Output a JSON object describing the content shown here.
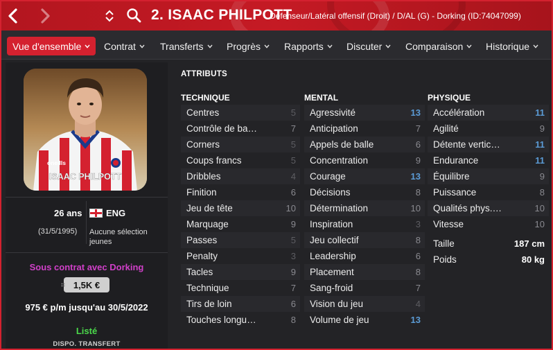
{
  "header": {
    "title": "2. ISAAC PHILPOTT",
    "subtitle": "Défenseur/Latéral offensif (Droit) / D/AL (G) - Dorking (ID:74047099)",
    "colors": {
      "accent": "#d4212f"
    }
  },
  "tabs": [
    {
      "label": "Vue d'ensemble",
      "active": true
    },
    {
      "label": "Contrat"
    },
    {
      "label": "Transferts"
    },
    {
      "label": "Progrès"
    },
    {
      "label": "Rapports"
    },
    {
      "label": "Discuter"
    },
    {
      "label": "Comparaison"
    },
    {
      "label": "Historique"
    }
  ],
  "profile": {
    "shirt_name": "ISAAC PHILPOTT",
    "shirt_brand": "oneills",
    "age": "26 ans",
    "nationality": "ENG",
    "dob": "(31/5/1995)",
    "youth": "Aucune sélection jeunes",
    "contract": "Sous contrat avec Dorking",
    "value": "1,5K €",
    "wage": "975 € p/m jusqu'au 30/5/2022",
    "transfer_status": "Listé",
    "transfer_label": "DISPO. TRANSFERT"
  },
  "attributes": {
    "title": "ATTRIBUTS",
    "technique": {
      "heading": "TECHNIQUE",
      "rows": [
        {
          "name": "Centres",
          "value": "5"
        },
        {
          "name": "Contrôle de ba…",
          "value": "7"
        },
        {
          "name": "Corners",
          "value": "5"
        },
        {
          "name": "Coups francs",
          "value": "5"
        },
        {
          "name": "Dribbles",
          "value": "4"
        },
        {
          "name": "Finition",
          "value": "6"
        },
        {
          "name": "Jeu de tête",
          "value": "10"
        },
        {
          "name": "Marquage",
          "value": "9"
        },
        {
          "name": "Passes",
          "value": "5"
        },
        {
          "name": "Penalty",
          "value": "3"
        },
        {
          "name": "Tacles",
          "value": "9"
        },
        {
          "name": "Technique",
          "value": "7"
        },
        {
          "name": "Tirs de loin",
          "value": "6"
        },
        {
          "name": "Touches longu…",
          "value": "8"
        }
      ]
    },
    "mental": {
      "heading": "MENTAL",
      "rows": [
        {
          "name": "Agressivité",
          "value": "13"
        },
        {
          "name": "Anticipation",
          "value": "7"
        },
        {
          "name": "Appels de balle",
          "value": "6"
        },
        {
          "name": "Concentration",
          "value": "9"
        },
        {
          "name": "Courage",
          "value": "13"
        },
        {
          "name": "Décisions",
          "value": "8"
        },
        {
          "name": "Détermination",
          "value": "10"
        },
        {
          "name": "Inspiration",
          "value": "3"
        },
        {
          "name": "Jeu collectif",
          "value": "8"
        },
        {
          "name": "Leadership",
          "value": "6"
        },
        {
          "name": "Placement",
          "value": "8"
        },
        {
          "name": "Sang-froid",
          "value": "7"
        },
        {
          "name": "Vision du jeu",
          "value": "4"
        },
        {
          "name": "Volume de jeu",
          "value": "13"
        }
      ]
    },
    "physique": {
      "heading": "PHYSIQUE",
      "rows": [
        {
          "name": "Accélération",
          "value": "11"
        },
        {
          "name": "Agilité",
          "value": "9"
        },
        {
          "name": "Détente vertic…",
          "value": "11"
        },
        {
          "name": "Endurance",
          "value": "11"
        },
        {
          "name": "Équilibre",
          "value": "9"
        },
        {
          "name": "Puissance",
          "value": "8"
        },
        {
          "name": "Qualités phys.…",
          "value": "10"
        },
        {
          "name": "Vitesse",
          "value": "10"
        }
      ],
      "extra": [
        {
          "name": "Taille",
          "value": "187 cm"
        },
        {
          "name": "Poids",
          "value": "80 kg"
        }
      ]
    }
  }
}
